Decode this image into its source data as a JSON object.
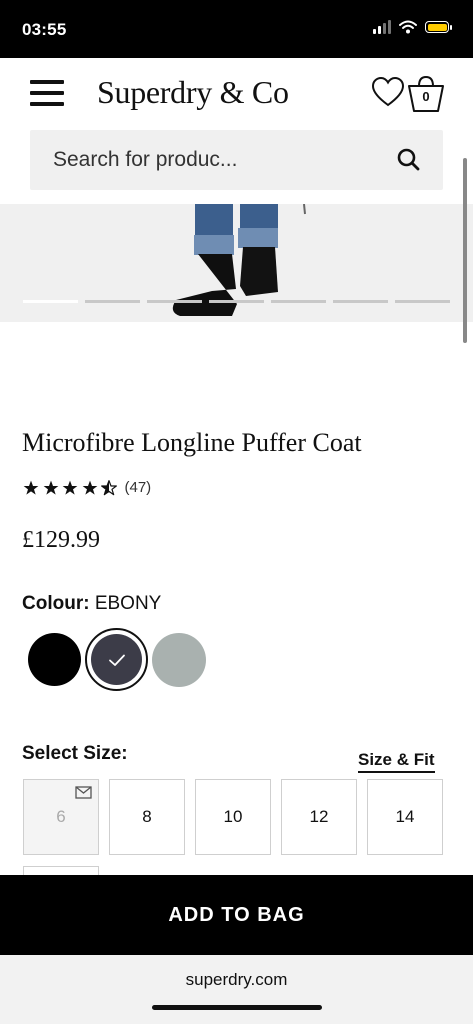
{
  "status_bar": {
    "time": "03:55"
  },
  "header": {
    "logo": "Superdry & Co",
    "bag_count": "0"
  },
  "search": {
    "placeholder": "Search for produc..."
  },
  "carousel": {
    "total_slides": 7,
    "active_slide": 1
  },
  "product": {
    "title": "Microfibre Longline Puffer Coat",
    "rating": 4.5,
    "review_count": "(47)",
    "price": "£129.99"
  },
  "colour": {
    "label": "Colour:",
    "selected_name": "EBONY",
    "swatches": [
      {
        "color": "#000000"
      },
      {
        "color": "#3c3c48",
        "selected": true
      },
      {
        "color": "#a9b1af"
      }
    ]
  },
  "size": {
    "label": "Select Size:",
    "size_fit_link": "Size & Fit",
    "options": [
      {
        "label": "6",
        "in_stock": false
      },
      {
        "label": "8",
        "in_stock": true
      },
      {
        "label": "10",
        "in_stock": true
      },
      {
        "label": "12",
        "in_stock": true
      },
      {
        "label": "14",
        "in_stock": true
      }
    ]
  },
  "add_to_bag": "ADD TO BAG",
  "browser": {
    "url": "superdry.com"
  },
  "icons": [
    "menu-icon",
    "heart-icon",
    "bag-icon",
    "search-icon",
    "check-icon",
    "envelope-icon",
    "star-icon",
    "half-star-icon"
  ]
}
